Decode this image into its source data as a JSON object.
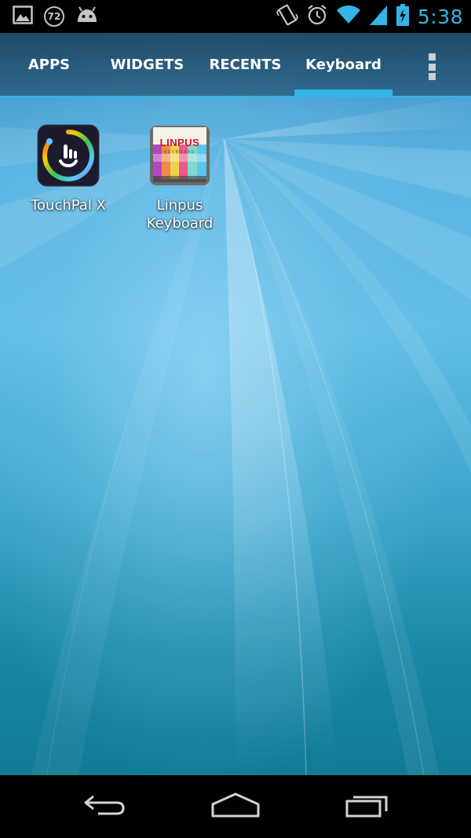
{
  "status_bar": {
    "time": "5:38",
    "notification_count": "72",
    "left_icons": [
      "gallery-icon",
      "notification-count-badge",
      "android-icon"
    ],
    "right_icons": [
      "vibrate-icon",
      "alarm-icon",
      "wifi-icon",
      "signal-icon",
      "battery-charging-icon"
    ],
    "accent_color": "#33b5e5"
  },
  "tabs": [
    {
      "label": "APPS",
      "selected": false
    },
    {
      "label": "WIDGETS",
      "selected": false
    },
    {
      "label": "RECENTS",
      "selected": false
    },
    {
      "label": "Keyboard",
      "selected": true
    }
  ],
  "overflow_menu_icon": "overflow-menu-icon",
  "apps": [
    {
      "label": "TouchPal X",
      "icon": "touchpal-x-icon"
    },
    {
      "label": "Linpus Keyboard",
      "icon": "linpus-keyboard-icon",
      "icon_text": "LINPUS",
      "icon_subtext": "KEYBOARD"
    }
  ],
  "nav_bar": {
    "buttons": [
      "back-icon",
      "home-icon",
      "recent-apps-icon"
    ]
  }
}
